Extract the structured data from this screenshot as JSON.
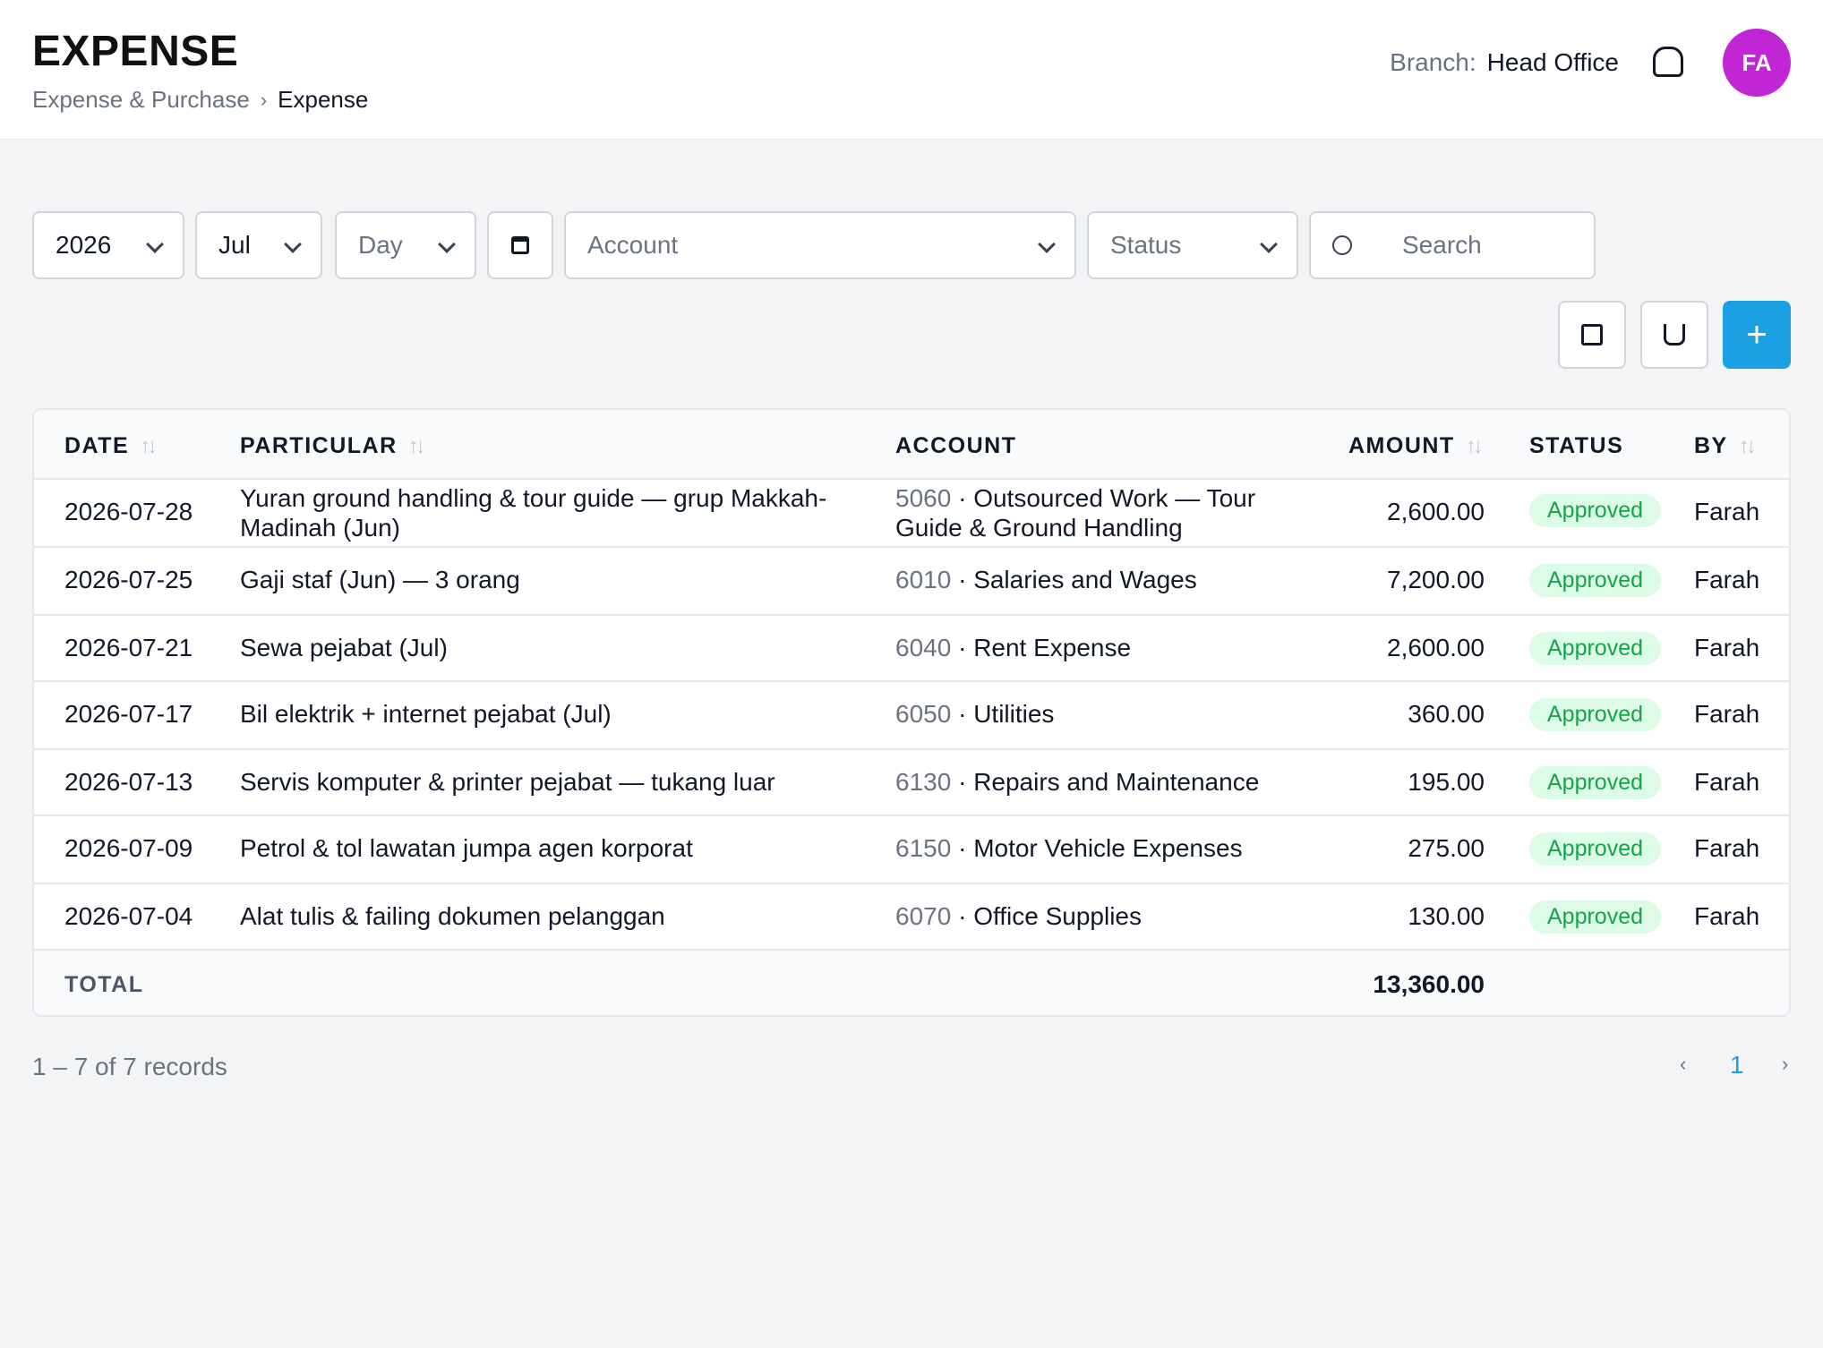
{
  "header": {
    "title": "EXPENSE",
    "breadcrumb": {
      "parent": "Expense & Purchase",
      "separator": "›",
      "current": "Expense"
    },
    "branch_label": "Branch:",
    "branch_value": "Head Office",
    "avatar_initials": "FA",
    "avatar_color": "#c026d3"
  },
  "filters": {
    "year": "2026",
    "month": "Jul",
    "day_placeholder": "Day",
    "account_placeholder": "Account",
    "status_placeholder": "Status",
    "search_placeholder": "Search"
  },
  "toolbar": {
    "add_label": "+",
    "accent_color": "#1ba0e2"
  },
  "table": {
    "columns": [
      "DATE",
      "PARTICULAR",
      "ACCOUNT",
      "AMOUNT",
      "STATUS",
      "BY"
    ],
    "rows": [
      {
        "date": "2026-07-28",
        "particular": "Yuran ground handling & tour guide — grup Makkah-Madinah (Jun)",
        "account_code": "5060",
        "account_name": "Outsourced Work — Tour Guide & Ground Handling",
        "amount": "2,600.00",
        "status": "Approved",
        "by": "Farah"
      },
      {
        "date": "2026-07-25",
        "particular": "Gaji staf (Jun) — 3 orang",
        "account_code": "6010",
        "account_name": "Salaries and Wages",
        "amount": "7,200.00",
        "status": "Approved",
        "by": "Farah"
      },
      {
        "date": "2026-07-21",
        "particular": "Sewa pejabat (Jul)",
        "account_code": "6040",
        "account_name": "Rent Expense",
        "amount": "2,600.00",
        "status": "Approved",
        "by": "Farah"
      },
      {
        "date": "2026-07-17",
        "particular": "Bil elektrik + internet pejabat (Jul)",
        "account_code": "6050",
        "account_name": "Utilities",
        "amount": "360.00",
        "status": "Approved",
        "by": "Farah"
      },
      {
        "date": "2026-07-13",
        "particular": "Servis komputer & printer pejabat — tukang luar",
        "account_code": "6130",
        "account_name": "Repairs and Maintenance",
        "amount": "195.00",
        "status": "Approved",
        "by": "Farah"
      },
      {
        "date": "2026-07-09",
        "particular": "Petrol & tol lawatan jumpa agen korporat",
        "account_code": "6150",
        "account_name": "Motor Vehicle Expenses",
        "amount": "275.00",
        "status": "Approved",
        "by": "Farah"
      },
      {
        "date": "2026-07-04",
        "particular": "Alat tulis & failing dokumen pelanggan",
        "account_code": "6070",
        "account_name": "Office Supplies",
        "amount": "130.00",
        "status": "Approved",
        "by": "Farah"
      }
    ],
    "total_label": "TOTAL",
    "total_amount": "13,360.00",
    "status_color": "#16a34a"
  },
  "pagination": {
    "summary": "1 – 7 of 7 records",
    "prev": "‹",
    "current_page": "1",
    "next": "›"
  }
}
